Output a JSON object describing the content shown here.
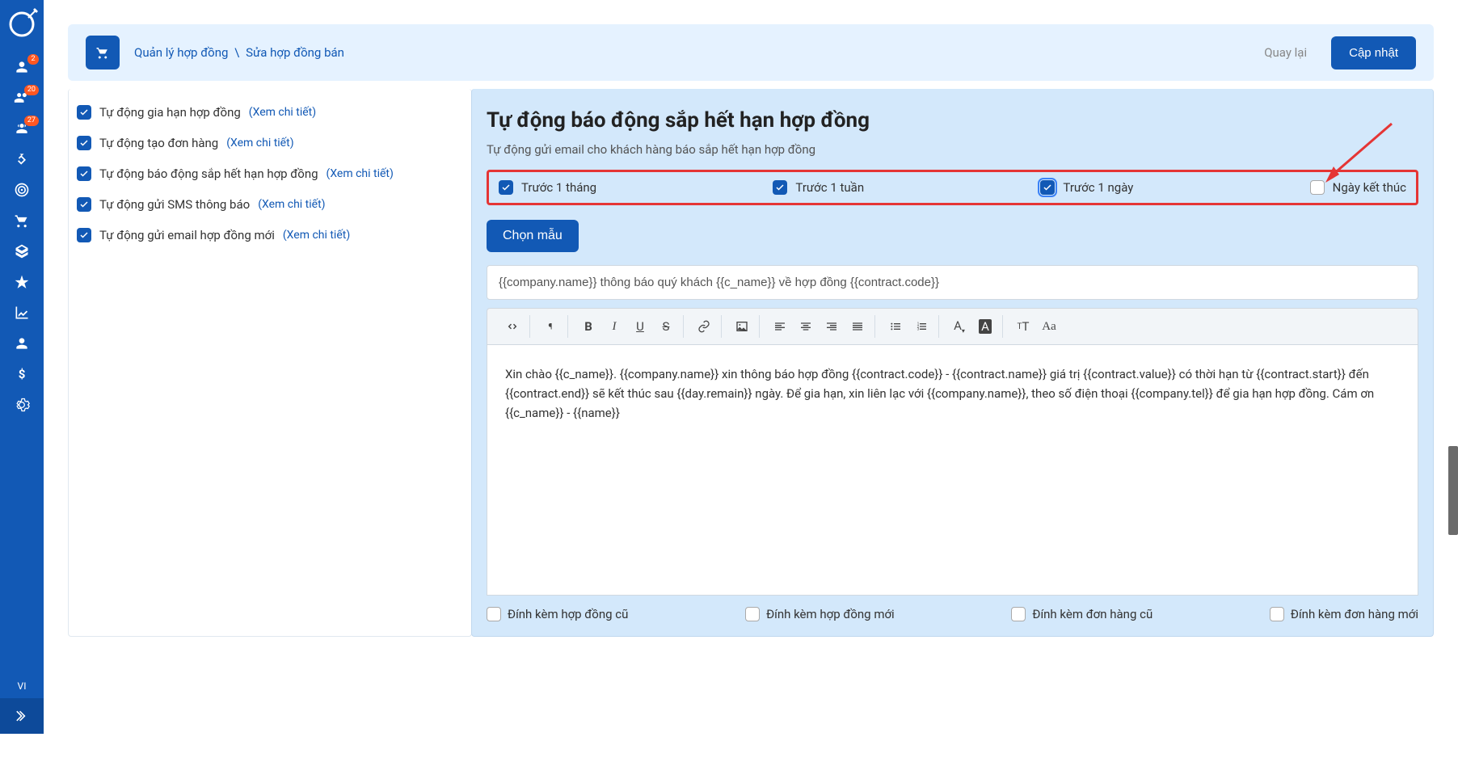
{
  "sidebar": {
    "badges": {
      "users": "2",
      "team": "20",
      "group": "27"
    },
    "lang": "VI"
  },
  "header": {
    "breadcrumb_1": "Quản lý hợp đồng",
    "breadcrumb_sep": "\\",
    "breadcrumb_2": "Sửa hợp đồng bán",
    "back_label": "Quay lại",
    "update_label": "Cập nhật"
  },
  "left_options": [
    {
      "label": "Tự động gia hạn hợp đồng",
      "detail": "(Xem chi tiết)"
    },
    {
      "label": "Tự động tạo đơn hàng",
      "detail": "(Xem chi tiết)"
    },
    {
      "label": "Tự động báo động sắp hết hạn hợp đồng",
      "detail": "(Xem chi tiết)"
    },
    {
      "label": "Tự động gửi SMS thông báo",
      "detail": "(Xem chi tiết)"
    },
    {
      "label": "Tự động gửi email hợp đồng mới",
      "detail": "(Xem chi tiết)"
    }
  ],
  "right": {
    "title": "Tự động báo động sắp hết hạn hợp đồng",
    "subtitle": "Tự động gửi email cho khách hàng báo sắp hết hạn hợp đồng",
    "timing": {
      "month": "Trước 1 tháng",
      "week": "Trước 1 tuần",
      "day": "Trước 1 ngày",
      "end": "Ngày kết thúc"
    },
    "template_btn": "Chọn mẫu",
    "subject": "{{company.name}} thông báo quý khách {{c_name}} về hợp đồng {{contract.code}}",
    "body": "Xin chào {{c_name}}. {{company.name}} xin thông báo hợp đồng {{contract.code}} - {{contract.name}} giá trị {{contract.value}} có thời hạn từ {{contract.start}} đến {{contract.end}} sẽ kết thúc sau {{day.remain}} ngày. Để gia hạn, xin liên lạc với {{company.name}}, theo số điện thoại {{company.tel}} để gia hạn hợp đồng. Cám ơn {{c_name}} - {{name}}",
    "attach": {
      "old_contract": "Đính kèm hợp đồng cũ",
      "new_contract": "Đính kèm hợp đồng mới",
      "old_order": "Đính kèm đơn hàng cũ",
      "new_order": "Đính kèm đơn hàng mới"
    }
  }
}
